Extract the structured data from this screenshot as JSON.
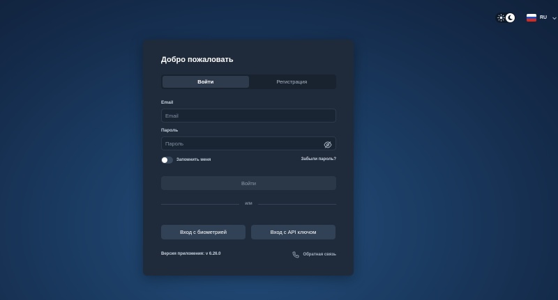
{
  "header": {
    "theme_toggle": {
      "light_icon": "sun-icon",
      "dark_icon": "moon-icon",
      "active": "dark"
    },
    "language": {
      "code": "RU",
      "flag": "russia-flag-icon",
      "chevron": "chevron-down-icon"
    }
  },
  "card": {
    "title": "Добро пожаловать",
    "tabs": [
      {
        "label": "Войти",
        "active": true
      },
      {
        "label": "Регистрация",
        "active": false
      }
    ],
    "email": {
      "label": "Email",
      "placeholder": "Email",
      "value": ""
    },
    "password": {
      "label": "Пароль",
      "placeholder": "Пароль",
      "value": "",
      "visibility_icon": "eye-off-icon"
    },
    "remember": {
      "label": "Запомнить меня",
      "checked": false
    },
    "forgot_label": "Забыли пароль?",
    "login_button": "Войти",
    "divider_label": "или",
    "biometric_button": "Вход с биометрией",
    "api_key_button": "Вход с API ключом",
    "version_text": "Версия приложения: v 6.26.0",
    "feedback": {
      "label": "Обратная связь",
      "icon": "phone-icon"
    }
  },
  "colors": {
    "background": "#1b3c63",
    "card": "#1f2b3b",
    "active_tab": "#2d3b4d",
    "secondary_button": "#324256"
  }
}
